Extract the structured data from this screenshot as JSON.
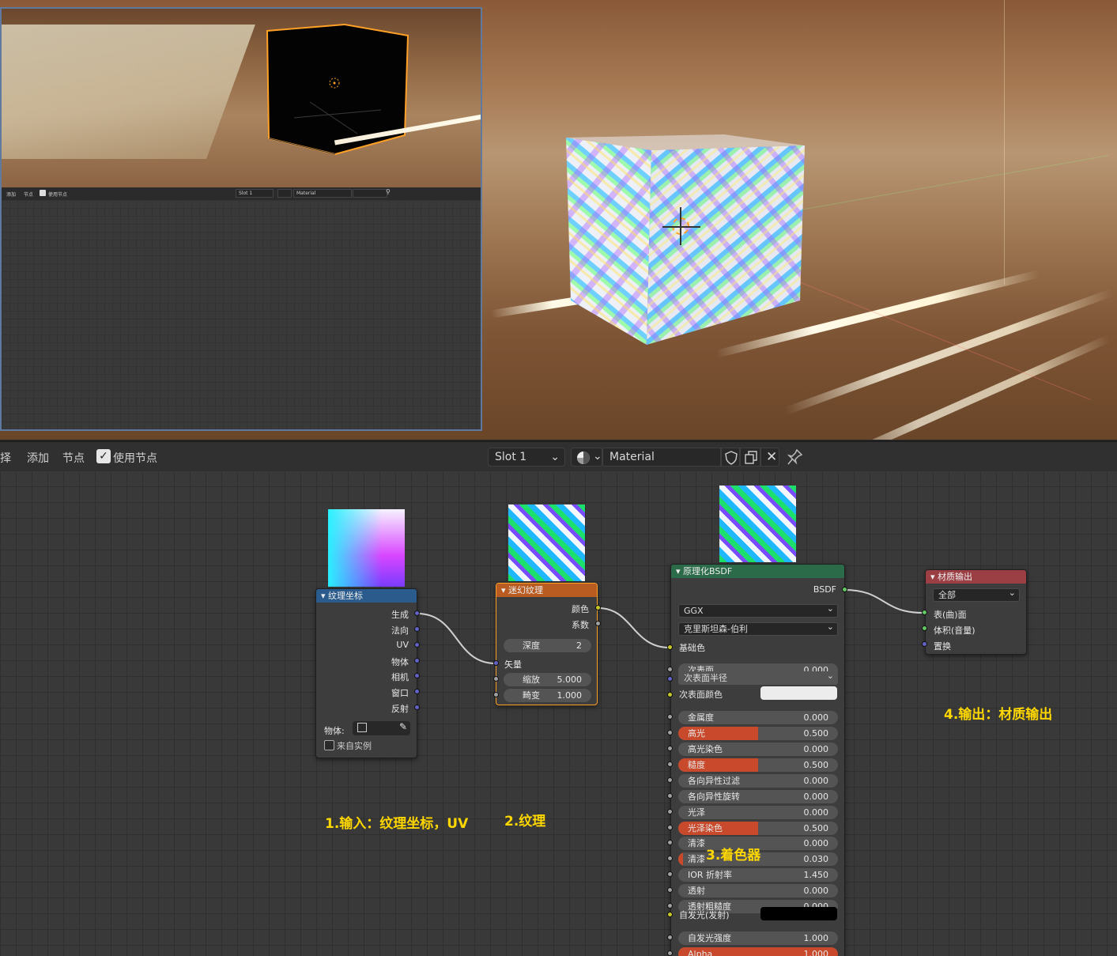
{
  "inset": {
    "toolbar": {
      "add": "添加",
      "node": "节点",
      "use_nodes": "使用节点",
      "slot": "Slot 1",
      "material": "Material"
    }
  },
  "header": {
    "select": "选择",
    "add": "添加",
    "node": "节点",
    "use_nodes": "使用节点",
    "use_nodes_checked": true,
    "slot": "Slot 1",
    "material": "Material"
  },
  "nodes": {
    "texcoord": {
      "title": "纹理坐标",
      "outputs": [
        "生成",
        "法向",
        "UV",
        "物体",
        "相机",
        "窗口",
        "反射"
      ],
      "object_label": "物体:",
      "from_instancer": "来自实例"
    },
    "magic": {
      "title": "迷幻纹理",
      "outputs": [
        "颜色",
        "系数"
      ],
      "depth_label": "深度",
      "depth_value": "2",
      "vector_label": "矢量",
      "scale_label": "缩放",
      "scale_value": "5.000",
      "distortion_label": "畸变",
      "distortion_value": "1.000"
    },
    "bsdf": {
      "title": "原理化BSDF",
      "output": "BSDF",
      "distribution": "GGX",
      "subsurface_method": "克里斯坦森-伯利",
      "base_color": "基础色",
      "subsurface_radius": "次表面半径",
      "subsurface_color": "次表面颜色",
      "emission": "自发光(发射)",
      "rows": [
        {
          "label": "次表面",
          "value": "0.000",
          "fill": 0
        },
        {
          "label": "金属度",
          "value": "0.000",
          "fill": 0
        },
        {
          "label": "高光",
          "value": "0.500",
          "fill": 0.5
        },
        {
          "label": "高光染色",
          "value": "0.000",
          "fill": 0
        },
        {
          "label": "糙度",
          "value": "0.500",
          "fill": 0.5
        },
        {
          "label": "各向异性过滤",
          "value": "0.000",
          "fill": 0
        },
        {
          "label": "各向异性旋转",
          "value": "0.000",
          "fill": 0
        },
        {
          "label": "光泽",
          "value": "0.000",
          "fill": 0
        },
        {
          "label": "光泽染色",
          "value": "0.500",
          "fill": 0.5
        },
        {
          "label": "清漆",
          "value": "0.000",
          "fill": 0
        },
        {
          "label": "清漆",
          "value": "0.030",
          "fill": 0.03
        },
        {
          "label": "IOR 折射率",
          "value": "1.450",
          "fill": 0
        },
        {
          "label": "透射",
          "value": "0.000",
          "fill": 0
        },
        {
          "label": "透射粗糙度",
          "value": "0.000",
          "fill": 0
        },
        {
          "label": "自发光强度",
          "value": "1.000",
          "fill": 0
        },
        {
          "label": "Alpha",
          "value": "1.000",
          "fill": 1
        }
      ]
    },
    "output": {
      "title": "材质输出",
      "target": "全部",
      "inputs": [
        "表(曲)面",
        "体积(音量)",
        "置换"
      ]
    }
  },
  "annotations": {
    "a1": "1.输入：纹理坐标，UV",
    "a2": "2.纹理",
    "a3": "3.着色器",
    "a4": "4.输出：材质输出"
  },
  "colors": {
    "accent": "#ffa027",
    "annotation": "#ffd700",
    "texcoord_header": "#2a5b8c",
    "magic_header": "#b85c22",
    "bsdf_header": "#2c6b4a",
    "output_header": "#9c3f45",
    "slider_fill": "#c8492b",
    "socket_vector": "#6363c7",
    "socket_color": "#c7c729",
    "socket_float": "#a1a1a1",
    "socket_shader": "#63c763"
  }
}
